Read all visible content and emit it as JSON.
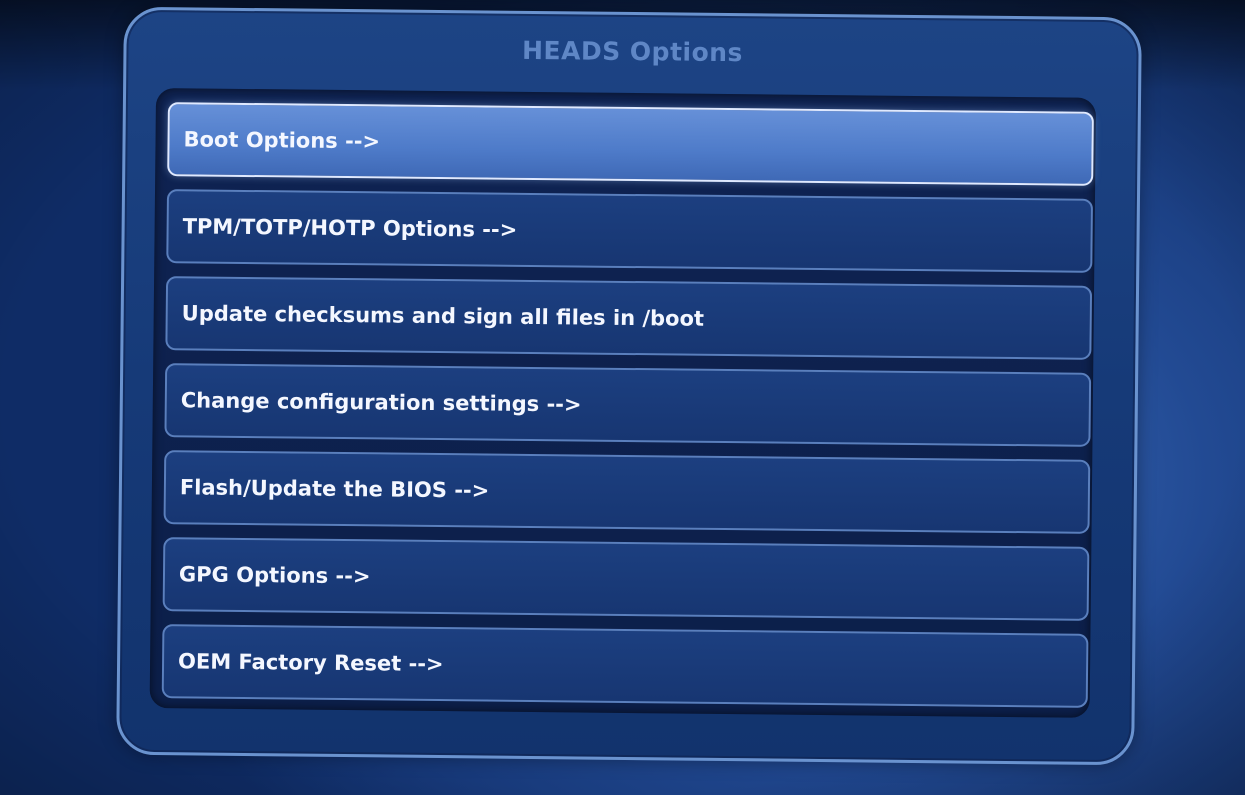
{
  "dialog": {
    "title": "HEADS Options"
  },
  "menu": {
    "selected_index": 0,
    "items": [
      {
        "label": "Boot Options -->"
      },
      {
        "label": "TPM/TOTP/HOTP Options -->"
      },
      {
        "label": "Update checksums and sign all files in /boot"
      },
      {
        "label": "Change configuration settings -->"
      },
      {
        "label": "Flash/Update the BIOS -->"
      },
      {
        "label": "GPG Options -->"
      },
      {
        "label": "OEM Factory Reset -->"
      }
    ]
  },
  "colors": {
    "background": "#224a93",
    "title": "#5f87c6",
    "selected_item": "#5a86d0",
    "item": "#1c3f80",
    "item_text": "#f4f7ff"
  }
}
